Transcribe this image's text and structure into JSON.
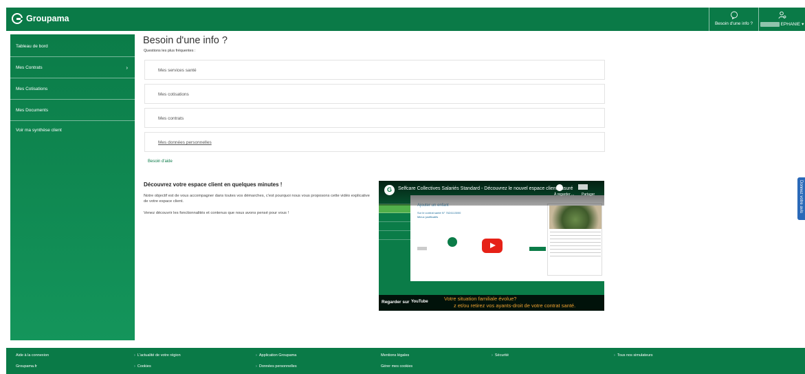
{
  "header": {
    "brand": "Groupama",
    "help_label": "Besoin d'une info ?",
    "user_name": "EPHANIE"
  },
  "sidebar": {
    "items": [
      {
        "label": "Tableau de bord"
      },
      {
        "label": "Mes Contrats"
      },
      {
        "label": "Mes Cotisations"
      },
      {
        "label": "Mes Documents"
      },
      {
        "label": "Voir ma synthèse client"
      }
    ]
  },
  "main": {
    "title": "Besoin d'une info ?",
    "faq_subtitle": "Questions les plus fréquentes :",
    "faq": [
      {
        "label": "Mes services santé"
      },
      {
        "label": "Mes cotisations"
      },
      {
        "label": "Mes contrats"
      },
      {
        "label": "Mes données personnelles"
      }
    ],
    "help_link": "Besoin d'aide",
    "discover_title": "Découvrez votre espace client en quelques minutes !",
    "discover_p1": "Notre objectif est de vous accompagner dans toutes vos démarches, c'est pourquoi nous vous proposons cette vidéo explicative de votre espace client.",
    "discover_p2": "Venez découvrir les fonctionnalités et contenus que nous avons pensé pour vous !"
  },
  "video": {
    "title": "Selfcare Collectives Salariés Standard - Découvrez le nouvel espace client assuré",
    "watch_later": "À regarder ...",
    "share": "Partager",
    "screen_title": "Ajouter un enfant",
    "screen_line1": "Sur le contrat santé N° 7624113000",
    "screen_line2": "Mieux justificatifs",
    "caption1": "Votre situation familiale évolue?",
    "caption2": "z et/ou retirez vos ayants-droit de votre contrat santé.",
    "watch_on": "Regarder sur",
    "youtube": "YouTube"
  },
  "feedback_label": "Donnez votre avis",
  "footer": {
    "row1": [
      "Aide à la connexion",
      "L'actualité de votre région",
      "Application Groupama",
      "Mentions légales",
      "Sécurité",
      "Tous nos simulateurs"
    ],
    "row2": [
      "Groupama.fr",
      "Cookies",
      "Données personnelles",
      "Gérer mes cookies"
    ]
  }
}
